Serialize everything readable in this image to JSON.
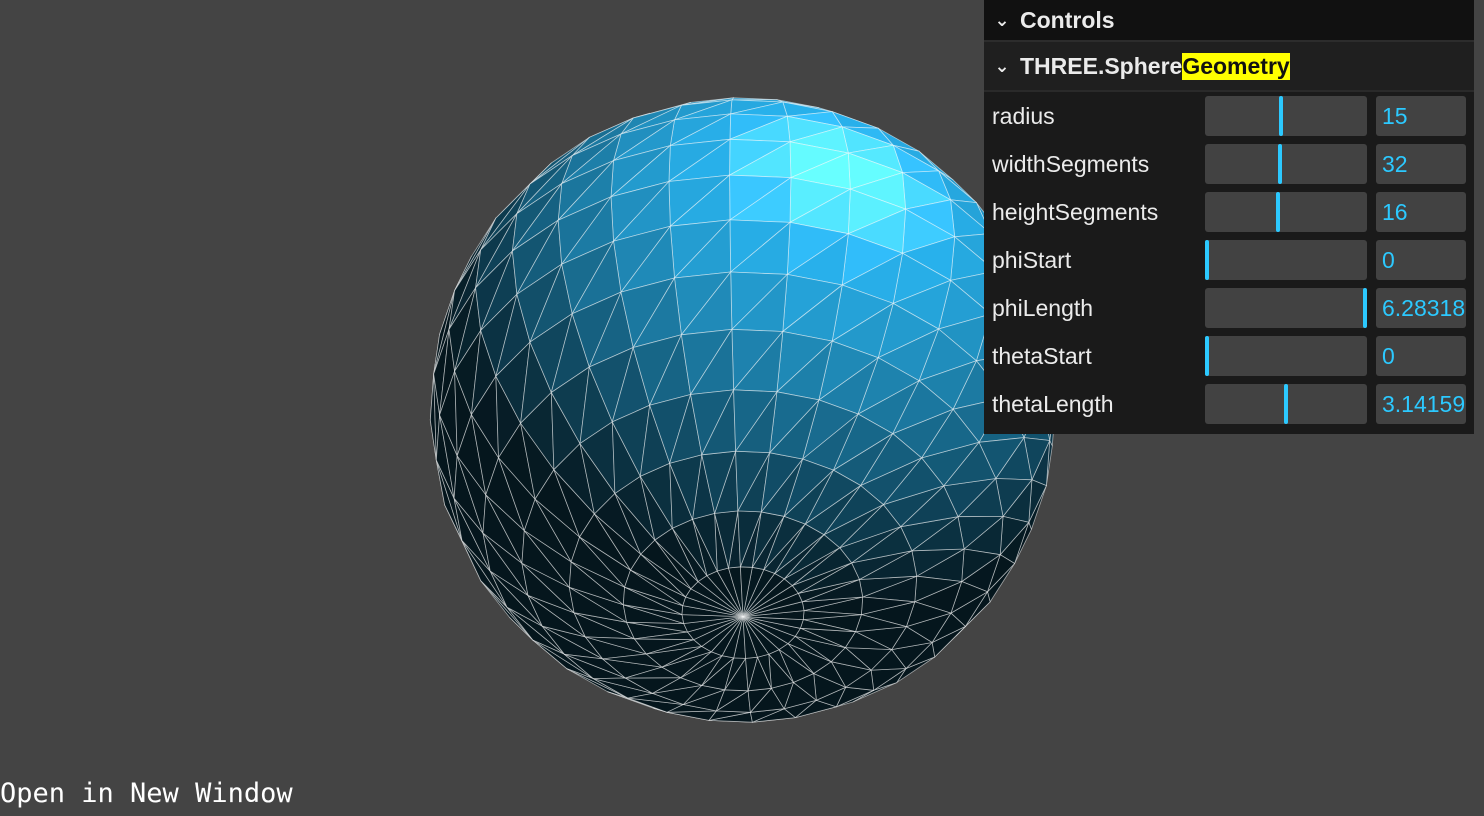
{
  "gui": {
    "title": "Controls",
    "folder": {
      "title_prefix": "THREE.Sphere",
      "title_highlight": "Geometry"
    },
    "params": [
      {
        "label": "radius",
        "value": "15",
        "fraction": 0.47
      },
      {
        "label": "widthSegments",
        "value": "32",
        "fraction": 0.46
      },
      {
        "label": "heightSegments",
        "value": "16",
        "fraction": 0.45
      },
      {
        "label": "phiStart",
        "value": "0",
        "fraction": 0.0
      },
      {
        "label": "phiLength",
        "value": "6.28318",
        "fraction": 1.0
      },
      {
        "label": "thetaStart",
        "value": "0",
        "fraction": 0.0
      },
      {
        "label": "thetaLength",
        "value": "3.14159",
        "fraction": 0.5
      }
    ],
    "accent_color": "#2cc9ff",
    "highlight_color": "#ffff00"
  },
  "link": {
    "label": "Open in New Window"
  },
  "scene": {
    "background": "#444444",
    "mesh_color": "#2ab8f5",
    "wireframe_color": "#ffffff",
    "geometry": "SphereGeometry"
  }
}
